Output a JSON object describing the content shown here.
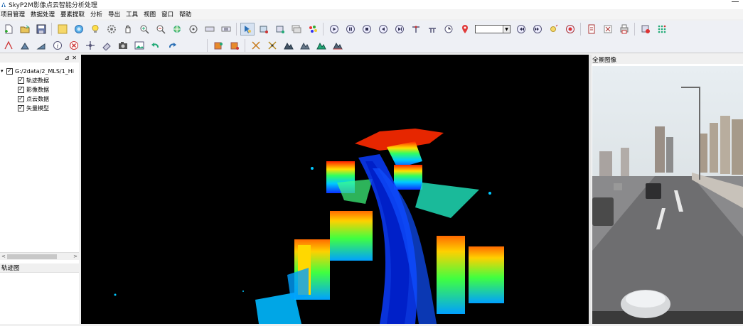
{
  "window": {
    "title": "SkyP2M影像点云智能分析处理"
  },
  "menu": [
    "项目管理",
    "数据处理",
    "要素提取",
    "分析",
    "导出",
    "工具",
    "视图",
    "窗口",
    "帮助"
  ],
  "layer_panel": {
    "root_label": "G:/2data/2_MLS/1_Hi",
    "children": [
      "轨迹数据",
      "影像数据",
      "点云数据",
      "矢量模型"
    ]
  },
  "track_panel": {
    "title": "轨迹图"
  },
  "panorama_panel": {
    "title": "全景图像"
  },
  "toolbar_combo": {
    "value": ""
  },
  "colors": {
    "viewport_bg": "#000000",
    "toolbar_bg": "#eef0f5",
    "menubar_bg": "#f4f4f4"
  }
}
